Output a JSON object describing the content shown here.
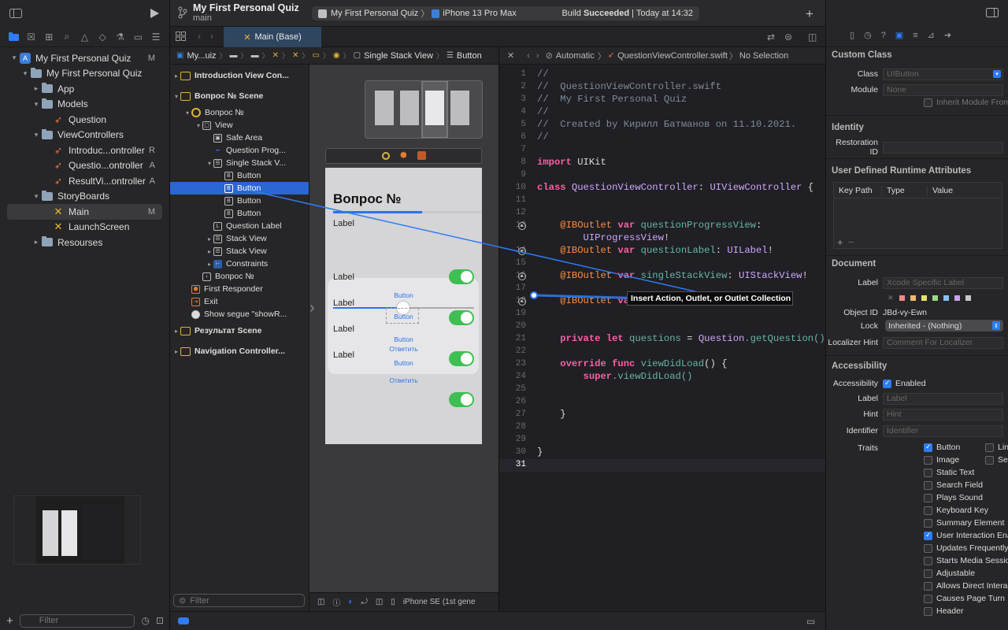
{
  "navigator": {
    "tree": [
      {
        "label": "My First Personal Quiz",
        "icon": "project",
        "indent": 0,
        "disclosure": "▾",
        "badge": "M"
      },
      {
        "label": "My First Personal Quiz",
        "icon": "folder",
        "indent": 1,
        "disclosure": "▾",
        "badge": ""
      },
      {
        "label": "App",
        "icon": "folder",
        "indent": 2,
        "disclosure": "▸",
        "badge": ""
      },
      {
        "label": "Models",
        "icon": "folder",
        "indent": 2,
        "disclosure": "▾",
        "badge": ""
      },
      {
        "label": "Question",
        "icon": "swift",
        "indent": 3,
        "disclosure": "",
        "badge": ""
      },
      {
        "label": "ViewControllers",
        "icon": "folder",
        "indent": 2,
        "disclosure": "▾",
        "badge": ""
      },
      {
        "label": "Introduc...ontroller",
        "icon": "swift",
        "indent": 3,
        "disclosure": "",
        "badge": "R"
      },
      {
        "label": "Questio...ontroller",
        "icon": "swift",
        "indent": 3,
        "disclosure": "",
        "badge": "A"
      },
      {
        "label": "ResultVi...ontroller",
        "icon": "swift",
        "indent": 3,
        "disclosure": "",
        "badge": "A"
      },
      {
        "label": "StoryBoards",
        "icon": "folder",
        "indent": 2,
        "disclosure": "▾",
        "badge": ""
      },
      {
        "label": "Main",
        "icon": "storyboard",
        "indent": 3,
        "disclosure": "",
        "badge": "M",
        "selected": true
      },
      {
        "label": "LaunchScreen",
        "icon": "storyboard",
        "indent": 3,
        "disclosure": "",
        "badge": ""
      },
      {
        "label": "Resourses",
        "icon": "folder",
        "indent": 2,
        "disclosure": "▸",
        "badge": ""
      }
    ],
    "filter_placeholder": "Filter"
  },
  "toolbar": {
    "project_title": "My First Personal Quiz",
    "branch": "main",
    "scheme_target": "My First Personal Quiz",
    "device": "iPhone 13 Pro Max",
    "build_prefix": "Build ",
    "build_status": "Succeeded",
    "build_time": " | Today at 14:32"
  },
  "editor_tab": {
    "label": "Main (Base)"
  },
  "jump_bar_left": [
    "My...uiz",
    "",
    "",
    "",
    "",
    "",
    "",
    "Single Stack View",
    "Button"
  ],
  "jump_bar_right": {
    "mode": "Automatic",
    "file": "QuestionViewController.swift",
    "selection": "No Selection"
  },
  "outline": {
    "rows": [
      {
        "label": "Introduction View Con...",
        "type": "scene",
        "indent": 0,
        "disc": "▸"
      },
      {
        "label": "Вопрос № Scene",
        "type": "scene",
        "indent": 0,
        "disc": "▾"
      },
      {
        "label": "Вопрос №",
        "type": "vc",
        "indent": 1,
        "disc": "▾"
      },
      {
        "label": "View",
        "type": "view",
        "indent": 2,
        "disc": "▾"
      },
      {
        "label": "Safe Area",
        "type": "safe",
        "indent": 3,
        "disc": ""
      },
      {
        "label": "Question Prog...",
        "type": "progress",
        "indent": 3,
        "disc": ""
      },
      {
        "label": "Single Stack V...",
        "type": "stack",
        "indent": 3,
        "disc": "▾"
      },
      {
        "label": "Button",
        "type": "button",
        "indent": 4,
        "disc": ""
      },
      {
        "label": "Button",
        "type": "button",
        "indent": 4,
        "disc": "",
        "highlight": true
      },
      {
        "label": "Button",
        "type": "button",
        "indent": 4,
        "disc": ""
      },
      {
        "label": "Button",
        "type": "button",
        "indent": 4,
        "disc": ""
      },
      {
        "label": "Question Label",
        "type": "label",
        "indent": 3,
        "disc": ""
      },
      {
        "label": "Stack View",
        "type": "stack",
        "indent": 3,
        "disc": "▸"
      },
      {
        "label": "Stack View",
        "type": "stack",
        "indent": 3,
        "disc": "▸"
      },
      {
        "label": "Constraints",
        "type": "constraints",
        "indent": 3,
        "disc": "▸"
      },
      {
        "label": "Вопрос №",
        "type": "nav",
        "indent": 2,
        "disc": ""
      },
      {
        "label": "First Responder",
        "type": "responder",
        "indent": 1,
        "disc": ""
      },
      {
        "label": "Exit",
        "type": "exit",
        "indent": 1,
        "disc": ""
      },
      {
        "label": "Show segue \"showR...",
        "type": "segue",
        "indent": 1,
        "disc": ""
      },
      {
        "label": "Результат Scene",
        "type": "scene",
        "indent": 0,
        "disc": "▸"
      },
      {
        "label": "Navigation Controller...",
        "type": "scene",
        "indent": 0,
        "disc": "▸"
      }
    ],
    "filter_placeholder": "Filter"
  },
  "canvas": {
    "title": "Вопрос №",
    "question_label": "Label",
    "progress_fraction": 0.6,
    "switch_rows": [
      "Label",
      "Label",
      "Label",
      "Label"
    ],
    "button_labels": [
      "Button",
      "Button",
      "Button",
      "Ответить",
      "Button",
      "Ответить"
    ],
    "device_label": "iPhone SE (1st gene"
  },
  "code": {
    "lines": [
      {
        "n": 1,
        "t": "//",
        "c": "cm"
      },
      {
        "n": 2,
        "t": "//  QuestionViewController.swift",
        "c": "cm"
      },
      {
        "n": 3,
        "t": "//  My First Personal Quiz",
        "c": "cm"
      },
      {
        "n": 4,
        "t": "//",
        "c": "cm"
      },
      {
        "n": 5,
        "t": "//  Created by Кирилл Батманов on 11.10.2021.",
        "c": "cm"
      },
      {
        "n": 6,
        "t": "//",
        "c": "cm"
      },
      {
        "n": 7,
        "t": "",
        "c": ""
      },
      {
        "n": 8,
        "t": "",
        "c": "import"
      },
      {
        "n": 9,
        "t": "",
        "c": ""
      },
      {
        "n": 10,
        "t": "",
        "c": "class"
      },
      {
        "n": 11,
        "t": "",
        "c": ""
      },
      {
        "n": 12,
        "t": "",
        "c": ""
      },
      {
        "n": 13,
        "t": "",
        "c": "outlet1"
      },
      {
        "n": "",
        "t": "",
        "c": "outlet1b"
      },
      {
        "n": 14,
        "t": "",
        "c": "outlet2"
      },
      {
        "n": 15,
        "t": "",
        "c": ""
      },
      {
        "n": 16,
        "t": "",
        "c": "outlet3"
      },
      {
        "n": 17,
        "t": "",
        "c": ""
      },
      {
        "n": 18,
        "t": "",
        "c": "outlet4"
      },
      {
        "n": 19,
        "t": "",
        "c": ""
      },
      {
        "n": 20,
        "t": "",
        "c": ""
      },
      {
        "n": 21,
        "t": "",
        "c": "private"
      },
      {
        "n": 22,
        "t": "",
        "c": ""
      },
      {
        "n": 23,
        "t": "",
        "c": "override"
      },
      {
        "n": 24,
        "t": "",
        "c": "super"
      },
      {
        "n": 25,
        "t": "",
        "c": ""
      },
      {
        "n": 26,
        "t": "",
        "c": ""
      },
      {
        "n": 27,
        "t": "    }",
        "c": ""
      },
      {
        "n": 28,
        "t": "",
        "c": ""
      },
      {
        "n": 29,
        "t": "",
        "c": ""
      },
      {
        "n": 30,
        "t": "}",
        "c": ""
      },
      {
        "n": 31,
        "t": "",
        "c": ""
      }
    ],
    "kw_import": "import",
    "uikit": " UIKit",
    "kw_class": "class",
    "class_name": " QuestionViewController",
    "colon": ": ",
    "super_type": "UIViewController",
    "brace": " {",
    "iboutlet": "@IBOutlet",
    "kw_var": " var",
    "o1_name": " questionProgressView",
    "o1_type": "UIProgressView",
    "o2_name": " questionLabel",
    "o2_type": "UILabel",
    "o3_name": " singleStackView",
    "o3_type": "UIStackView",
    "kw_private": "private",
    "kw_let": " let",
    "questions_name": " questions",
    "assign": " = ",
    "question_type": "Question",
    "get_question": ".getQuestion()",
    "kw_override": "override",
    "kw_func": " func",
    "view_did_load": " viewDidLoad",
    "parens": "() {",
    "kw_super": "super",
    "super_call": ".viewDidLoad()",
    "tooltip": "Insert Action, Outlet, or Outlet Collection",
    "exclaim": "!"
  },
  "inspector": {
    "custom_class": {
      "title": "Custom Class",
      "class_label": "Class",
      "class_value": "UIButton",
      "module_label": "Module",
      "module_value": "None",
      "inherit": "Inherit Module From Target"
    },
    "identity": {
      "title": "Identity",
      "restoration_label": "Restoration ID"
    },
    "runtime": {
      "title": "User Defined Runtime Attributes",
      "cols": [
        "Key Path",
        "Type",
        "Value"
      ],
      "add": "+",
      "remove": "−"
    },
    "document": {
      "title": "Document",
      "label_label": "Label",
      "label_placeholder": "Xcode Specific Label",
      "object_id_label": "Object ID",
      "object_id": "JBd-vy-Ewn",
      "lock_label": "Lock",
      "lock_value": "Inherited - (Nothing)",
      "localizer_label": "Localizer Hint",
      "localizer_placeholder": "Comment For Localizer",
      "swatches": [
        "#f08a8a",
        "#f2b870",
        "#e8e070",
        "#9cd88a",
        "#86c0f0",
        "#c9a0e8",
        "#c8c8c8"
      ]
    },
    "accessibility": {
      "title": "Accessibility",
      "access_label": "Accessibility",
      "enabled": "Enabled",
      "label_label": "Label",
      "label_placeholder": "Label",
      "hint_label": "Hint",
      "hint_placeholder": "Hint",
      "identifier_label": "Identifier",
      "identifier_placeholder": "Identifier",
      "traits_label": "Traits",
      "traits_left": [
        {
          "t": "Button",
          "on": true
        },
        {
          "t": "Image",
          "on": false
        },
        {
          "t": "Static Text",
          "on": false
        },
        {
          "t": "Search Field",
          "on": false
        },
        {
          "t": "Plays Sound",
          "on": false
        },
        {
          "t": "Keyboard Key",
          "on": false
        },
        {
          "t": "Summary Element",
          "on": false
        },
        {
          "t": "User Interaction Enabled",
          "on": true
        },
        {
          "t": "Updates Frequently",
          "on": false
        },
        {
          "t": "Starts Media Session",
          "on": false
        },
        {
          "t": "Adjustable",
          "on": false
        },
        {
          "t": "Allows Direct Interaction",
          "on": false
        },
        {
          "t": "Causes Page Turn",
          "on": false
        },
        {
          "t": "Header",
          "on": false
        }
      ],
      "traits_right": [
        {
          "t": "Link",
          "on": false
        },
        {
          "t": "Selected",
          "on": false
        }
      ]
    }
  },
  "colors": {
    "accent": "#2d7cf6",
    "selection": "#2a66d4",
    "editor_bg": "#1f1f24",
    "keyword": "#fc5fa3",
    "type": "#d0a8ff",
    "comment": "#7f8c98"
  }
}
